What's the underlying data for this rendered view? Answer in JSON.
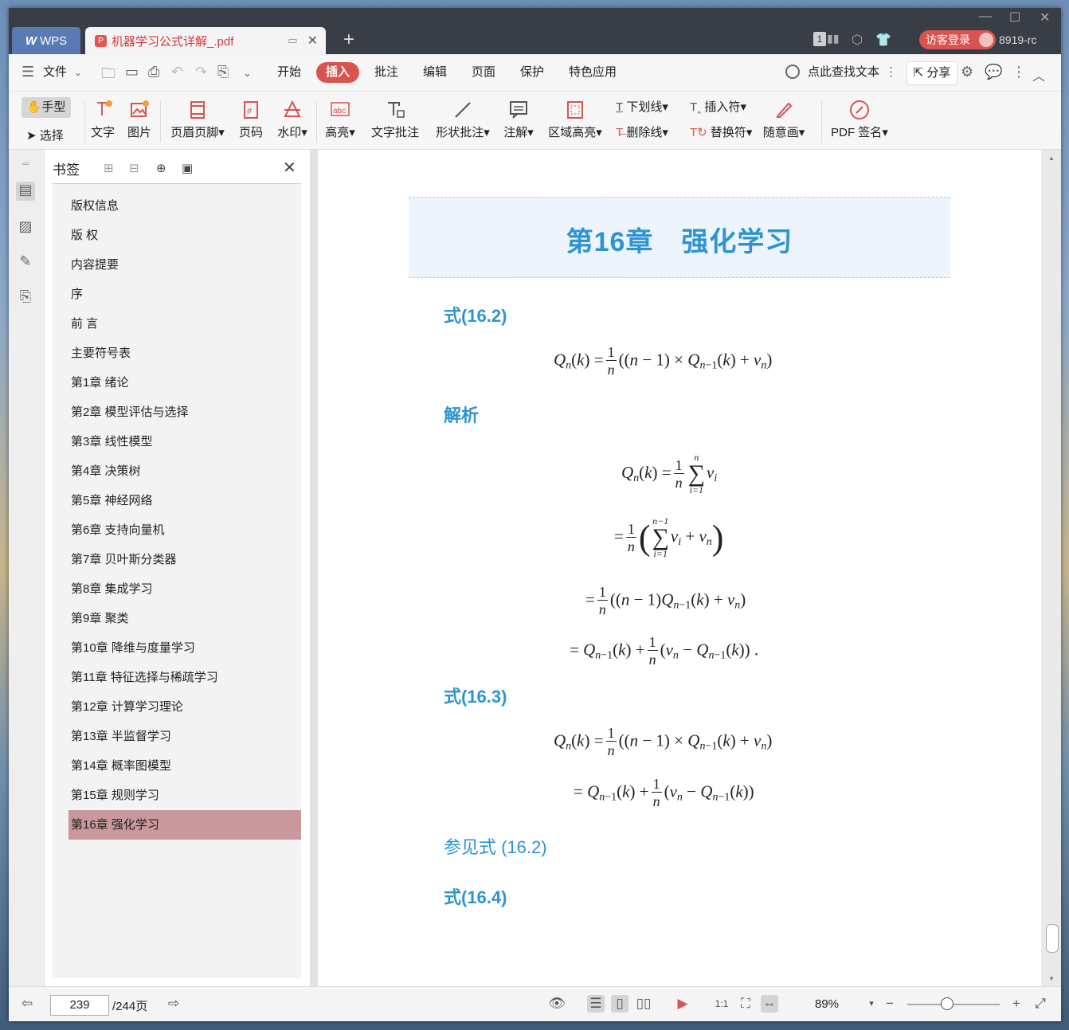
{
  "tabs": {
    "wps_label": "WPS",
    "doc_label": "机器学习公式详解_.pdf"
  },
  "titlebar": {
    "badge": "1",
    "login": "访客登录",
    "user": "8919-rc"
  },
  "menu": {
    "file": "文件",
    "items": [
      "开始",
      "插入",
      "批注",
      "编辑",
      "页面",
      "保护",
      "特色应用"
    ],
    "active": "插入",
    "search": "点此查找文本",
    "share": "分享"
  },
  "ribbon": {
    "hand": "手型",
    "select": "选择",
    "text": "文字",
    "image": "图片",
    "header_footer": "页眉页脚",
    "page_number": "页码",
    "watermark": "水印",
    "highlight": "高亮",
    "text_comment": "文字批注",
    "shape_comment": "形状批注",
    "note": "注解",
    "area_highlight": "区域高亮",
    "underline": "下划线",
    "strikethrough": "删除线",
    "insert_mark": "插入符",
    "replace_mark": "替换符",
    "freehand": "随意画",
    "pdf_sign": "PDF 签名"
  },
  "bookmarks": {
    "title": "书签",
    "items": [
      "版权信息",
      "版 权",
      "内容提要",
      "序",
      "前 言",
      "主要符号表",
      "第1章 绪论",
      "第2章 模型评估与选择",
      "第3章 线性模型",
      "第4章 决策树",
      "第5章 神经网络",
      "第6章 支持向量机",
      "第7章 贝叶斯分类器",
      "第8章 集成学习",
      "第9章 聚类",
      "第10章 降维与度量学习",
      "第11章 特征选择与稀疏学习",
      "第12章 计算学习理论",
      "第13章 半监督学习",
      "第14章 概率图模型",
      "第15章 规则学习",
      "第16章 强化学习"
    ],
    "selected": "第16章 强化学习"
  },
  "document": {
    "chapter_title": "第16章　强化学习",
    "sec1": "式(16.2)",
    "analysis": "解析",
    "sec2": "式(16.3)",
    "see_also": "参见式 (16.2)",
    "sec3": "式(16.4)"
  },
  "status": {
    "page": "239",
    "total": "/244页",
    "zoom": "89%"
  },
  "colors": {
    "accent": "#d9534f",
    "heading": "#2e94d1",
    "selected_bookmark": "#c9989c",
    "titlebar": "#383d46"
  }
}
